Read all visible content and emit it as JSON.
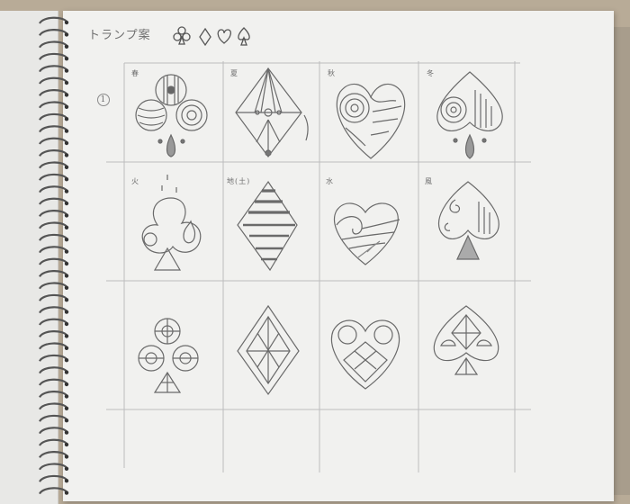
{
  "sketchbook": {
    "title": "トランプ案",
    "header_suits": [
      "club",
      "diamond",
      "heart",
      "spade"
    ],
    "row_number": "1",
    "cell_labels": [
      {
        "id": "spring",
        "text": "春"
      },
      {
        "id": "summer",
        "text": "夏"
      },
      {
        "id": "autumn",
        "text": "秋"
      },
      {
        "id": "winter",
        "text": "冬"
      },
      {
        "id": "fire",
        "text": "火"
      },
      {
        "id": "earth",
        "text": "地(土)"
      },
      {
        "id": "water",
        "text": "水"
      },
      {
        "id": "wind",
        "text": "風"
      }
    ],
    "rows": [
      {
        "theme": "seasons",
        "suits": [
          "club",
          "diamond",
          "heart",
          "spade"
        ]
      },
      {
        "theme": "elements",
        "suits": [
          "club",
          "diamond",
          "heart",
          "spade"
        ]
      },
      {
        "theme": "geometric",
        "suits": [
          "club",
          "diamond",
          "heart",
          "spade"
        ]
      }
    ],
    "colors": {
      "pencil": "#6f6f6f",
      "paper": "#f1f1ef",
      "desk": "#b8ab97"
    }
  }
}
